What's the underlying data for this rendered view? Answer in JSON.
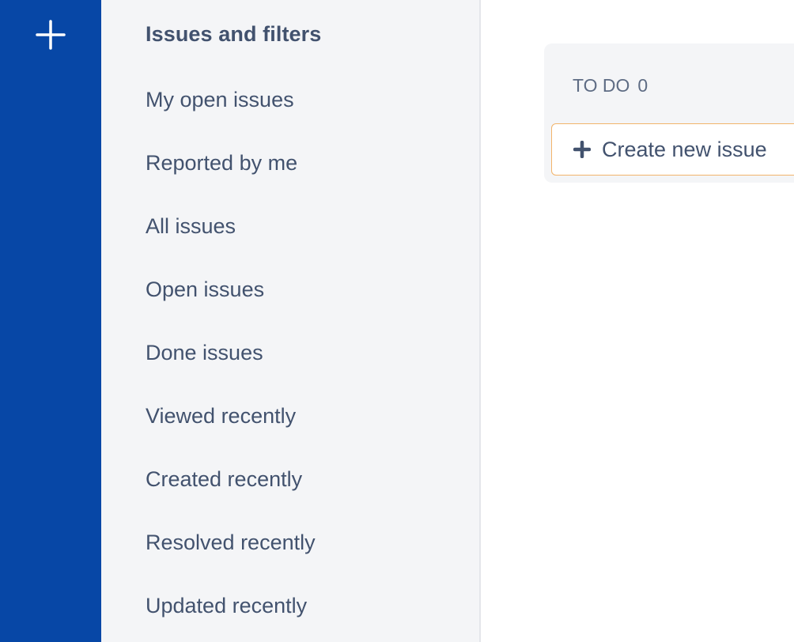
{
  "global_nav": {
    "create_icon": "plus-icon",
    "background": "#0747a6"
  },
  "sidebar": {
    "heading": "Issues and filters",
    "items": [
      {
        "label": "My open issues"
      },
      {
        "label": "Reported by me"
      },
      {
        "label": "All issues"
      },
      {
        "label": "Open issues"
      },
      {
        "label": "Done issues"
      },
      {
        "label": "Viewed recently"
      },
      {
        "label": "Created recently"
      },
      {
        "label": "Resolved recently"
      },
      {
        "label": "Updated recently"
      }
    ]
  },
  "board": {
    "column": {
      "title": "TO DO",
      "count": "0",
      "create_button": {
        "icon": "plus-icon",
        "label": "Create new issue"
      }
    }
  },
  "colors": {
    "text": "#42526e",
    "muted_text": "#5e6c84",
    "sidebar_bg": "#f4f5f7",
    "button_border": "#f2b46b"
  }
}
